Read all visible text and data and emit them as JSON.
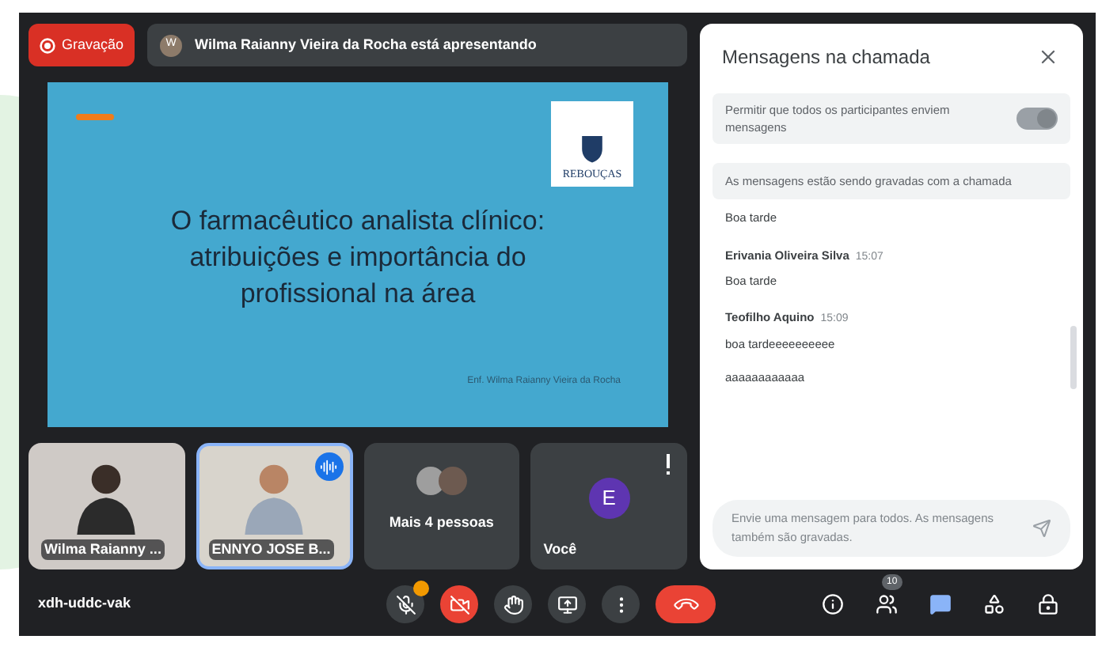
{
  "recording": {
    "label": "Gravação"
  },
  "presenter_bar": {
    "avatar_letter": "W",
    "text": "Wilma Raianny Vieira da Rocha está apresentando"
  },
  "slide": {
    "logo_text": "REBOUÇAS",
    "title": "O farmacêutico analista clínico: atribuições e importância do profissional na área",
    "author": "Enf. Wilma Raianny Vieira da Rocha"
  },
  "tiles": [
    {
      "kind": "video",
      "name": "Wilma Raianny ...",
      "speaking": false
    },
    {
      "kind": "video",
      "name": "ENNYO JOSE B...",
      "speaking": true
    },
    {
      "kind": "group",
      "name": "Mais 4 pessoas",
      "speaking": false
    },
    {
      "kind": "self",
      "name": "Você",
      "avatar_letter": "E",
      "speaking": false
    }
  ],
  "meeting_code": "xdh-uddc-vak",
  "controls": [
    {
      "kind": "mic",
      "on": false
    },
    {
      "kind": "camera",
      "on": false
    },
    {
      "kind": "hand"
    },
    {
      "kind": "present"
    },
    {
      "kind": "more"
    },
    {
      "kind": "hangup"
    }
  ],
  "side_controls": [
    {
      "kind": "info",
      "selected": false
    },
    {
      "kind": "people",
      "selected": false,
      "badge": "10"
    },
    {
      "kind": "chat",
      "selected": true
    },
    {
      "kind": "activities",
      "selected": false
    },
    {
      "kind": "lock",
      "selected": false
    }
  ],
  "chat": {
    "title": "Mensagens na chamada",
    "permission": {
      "label": "Permitir que todos os participantes enviem mensagens",
      "on": true
    },
    "notice": "As mensagens estão sendo gravadas com a chamada",
    "messages": [
      {
        "lines": [
          "Boa tarde"
        ]
      },
      {
        "author": "Erivania Oliveira Silva",
        "time": "15:07",
        "lines": [
          "Boa tarde"
        ]
      },
      {
        "author": "Teofilho Aquino",
        "time": "15:09",
        "lines": [
          "boa tardeeeeeeeeee",
          "aaaaaaaaaaaa"
        ]
      }
    ],
    "input": {
      "placeholder": "Envie uma mensagem para todos. As mensagens também são gravadas."
    }
  }
}
